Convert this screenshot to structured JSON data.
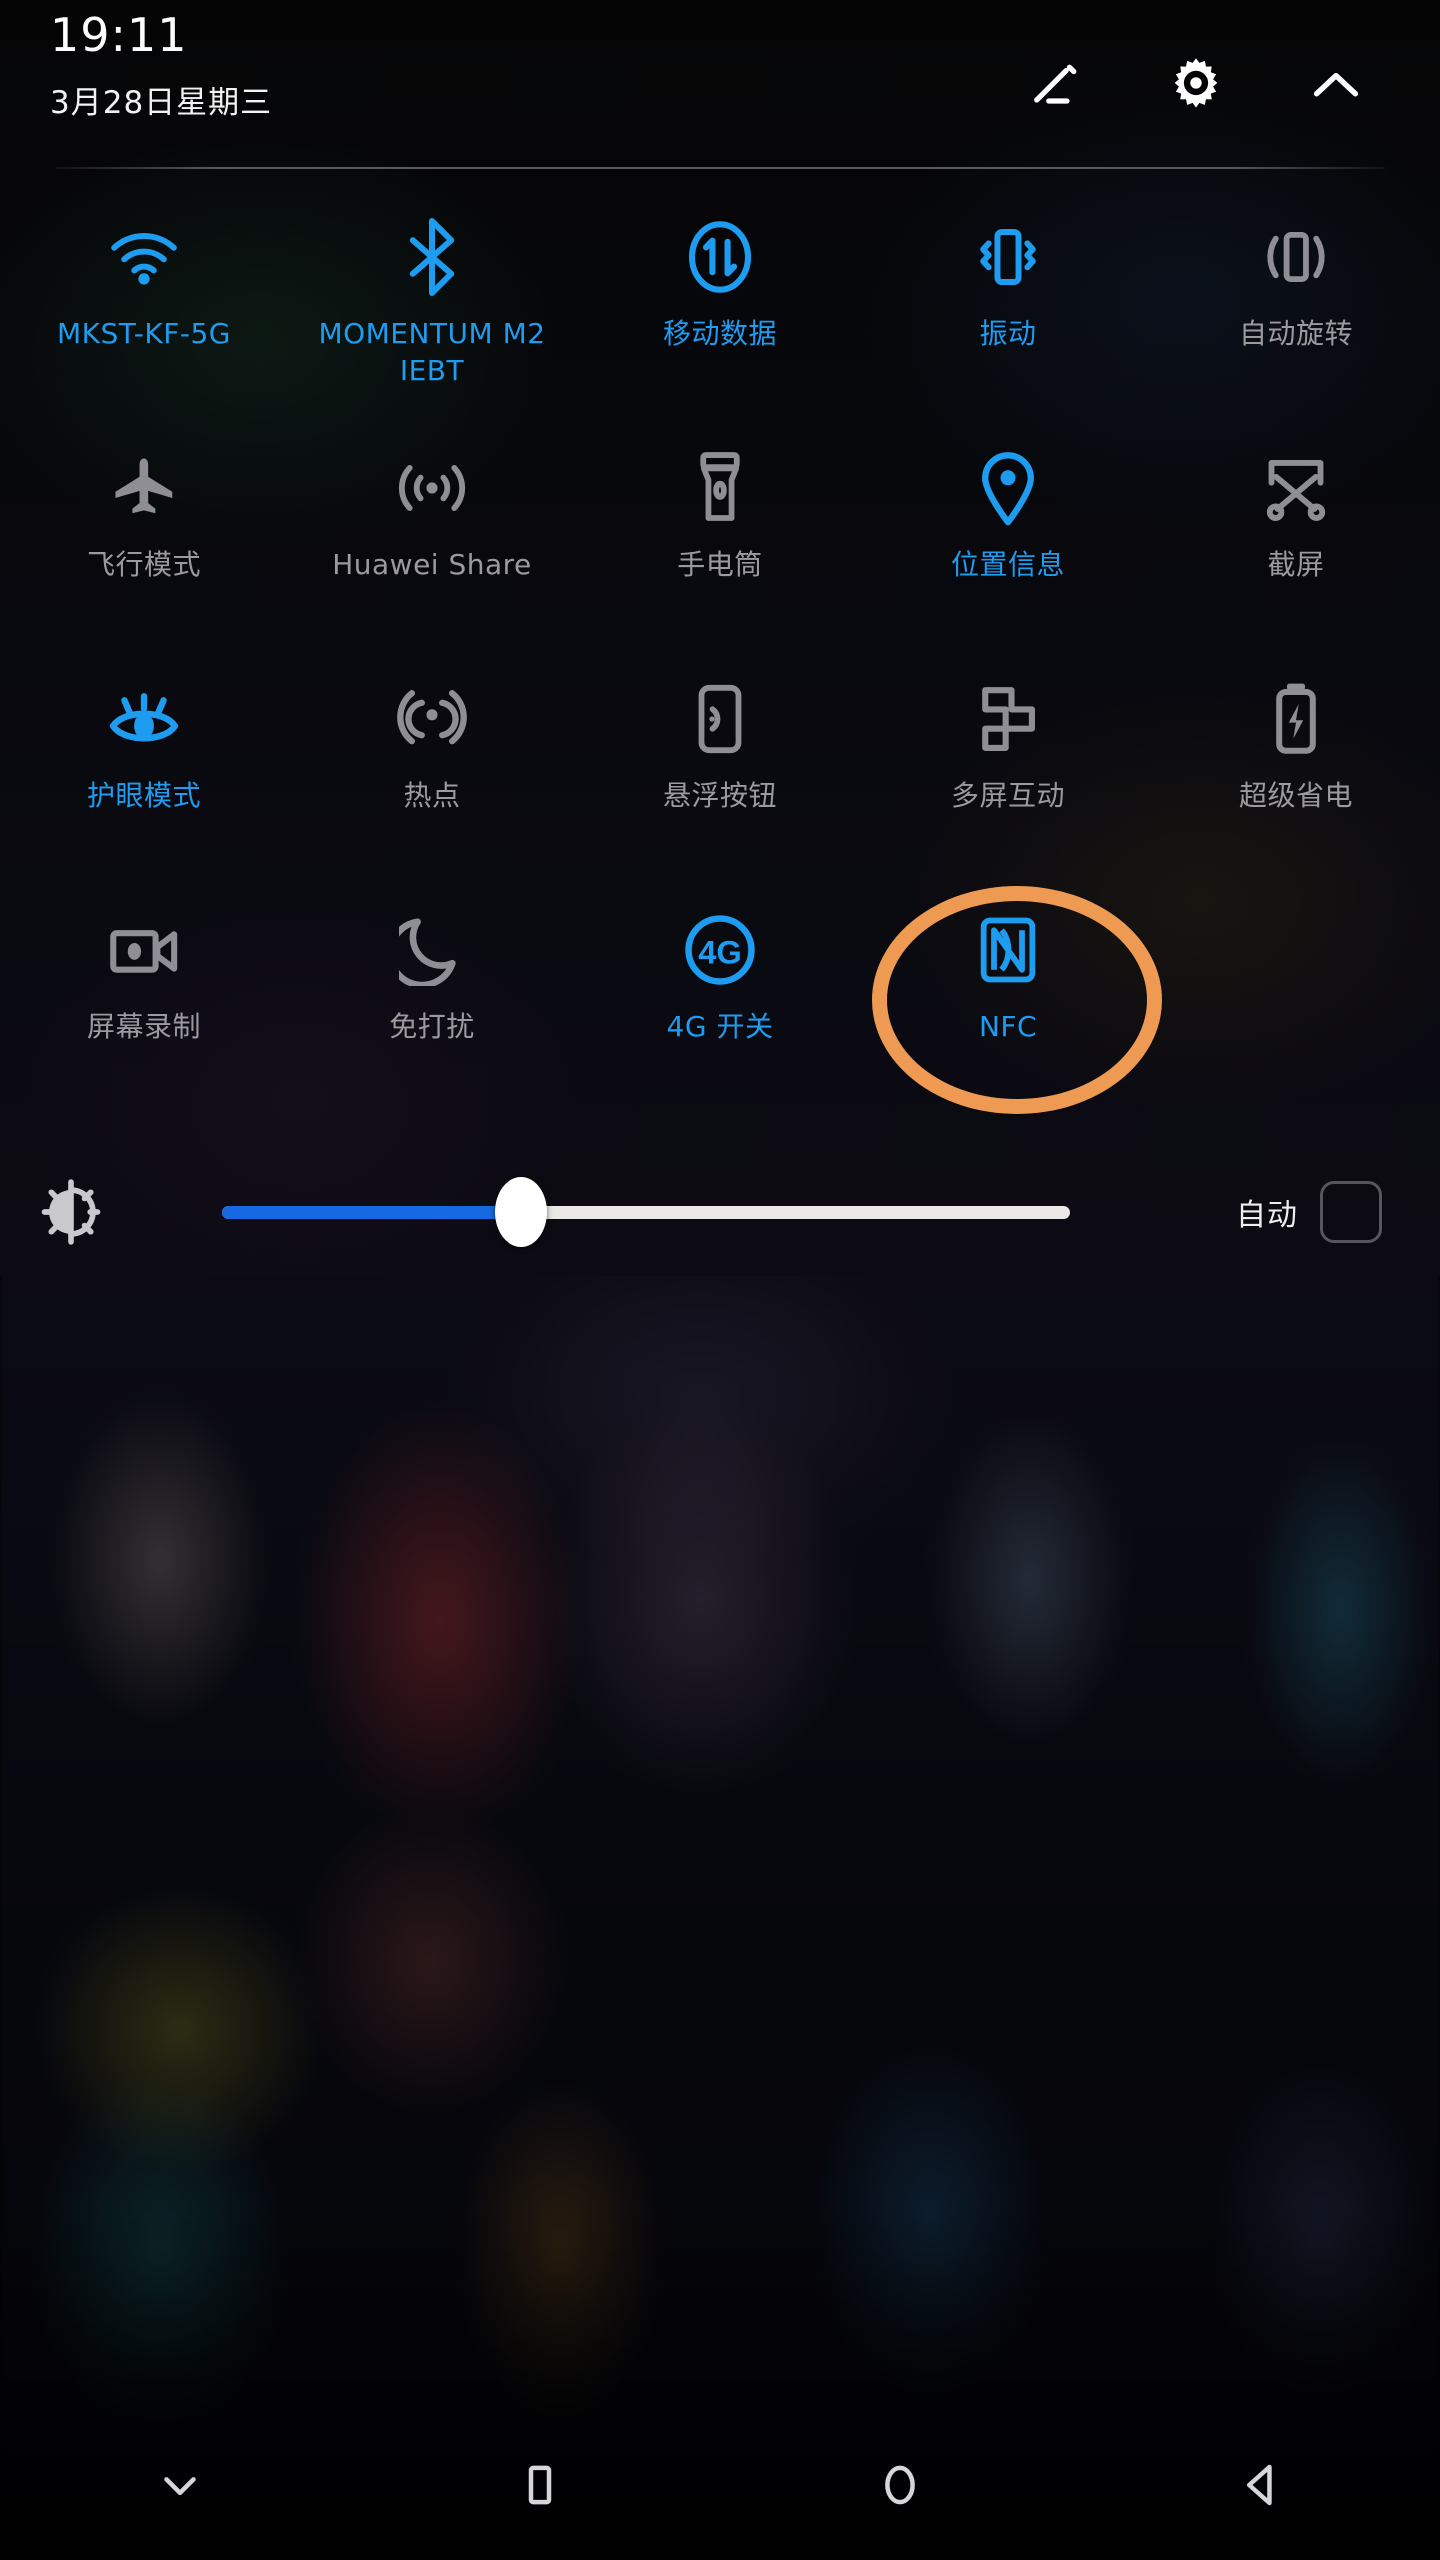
{
  "statusbar": {
    "time": "19:11",
    "date": "3月28日星期三"
  },
  "header": {
    "edit_icon": "pencil-edit-icon",
    "settings_icon": "gear-icon",
    "collapse_icon": "chevron-up-icon"
  },
  "toggles": [
    {
      "label": "MKST-KF-5G",
      "icon": "wifi-icon",
      "state": "on"
    },
    {
      "label": "MOMENTUM M2 IEBT",
      "icon": "bluetooth-icon",
      "state": "on"
    },
    {
      "label": "移动数据",
      "icon": "mobile-data-icon",
      "state": "on"
    },
    {
      "label": "振动",
      "icon": "vibrate-icon",
      "state": "on"
    },
    {
      "label": "自动旋转",
      "icon": "auto-rotate-icon",
      "state": "off"
    },
    {
      "label": "飞行模式",
      "icon": "airplane-icon",
      "state": "off"
    },
    {
      "label": "Huawei Share",
      "icon": "huawei-share-icon",
      "state": "off"
    },
    {
      "label": "手电筒",
      "icon": "flashlight-icon",
      "state": "off"
    },
    {
      "label": "位置信息",
      "icon": "location-pin-icon",
      "state": "on"
    },
    {
      "label": "截屏",
      "icon": "screenshot-icon",
      "state": "off"
    },
    {
      "label": "护眼模式",
      "icon": "eye-comfort-icon",
      "state": "on"
    },
    {
      "label": "热点",
      "icon": "hotspot-icon",
      "state": "off"
    },
    {
      "label": "悬浮按钮",
      "icon": "floating-button-icon",
      "state": "off"
    },
    {
      "label": "多屏互动",
      "icon": "multi-screen-icon",
      "state": "off"
    },
    {
      "label": "超级省电",
      "icon": "super-saver-icon",
      "state": "off"
    },
    {
      "label": "屏幕录制",
      "icon": "screen-record-icon",
      "state": "off"
    },
    {
      "label": "免打扰",
      "icon": "do-not-disturb-icon",
      "state": "off"
    },
    {
      "label": "4G 开关",
      "icon": "four-g-icon",
      "state": "on"
    },
    {
      "label": "NFC",
      "icon": "nfc-icon",
      "state": "on"
    }
  ],
  "annotation": {
    "target_label": "NFC",
    "shape": "ellipse",
    "color": "#ef9a52"
  },
  "brightness": {
    "icon": "brightness-icon",
    "value_percent": 38,
    "auto_label": "自动",
    "auto_checked": false
  },
  "navbar": [
    {
      "icon": "chevron-down-icon",
      "name": "collapse-panel"
    },
    {
      "icon": "square-icon",
      "name": "recents"
    },
    {
      "icon": "circle-icon",
      "name": "home"
    },
    {
      "icon": "triangle-left-icon",
      "name": "back"
    }
  ],
  "colors": {
    "accent_on": "#1e9cf0",
    "off": "#9a9a9f",
    "highlight": "#ef9a52",
    "slider_fill": "#1668e3"
  }
}
